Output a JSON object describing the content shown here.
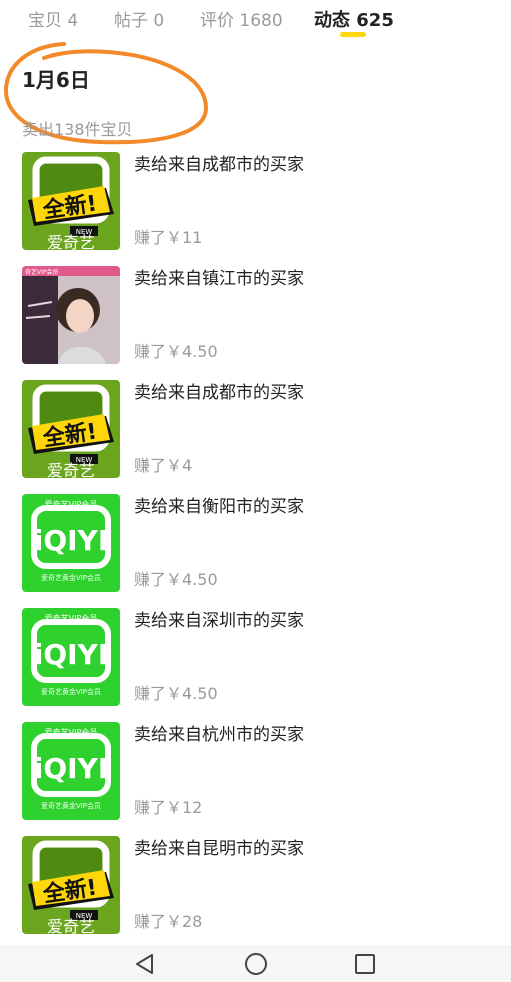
{
  "tabs": [
    {
      "label": "宝贝 4"
    },
    {
      "label": "帖子 0"
    },
    {
      "label": "评价 1680"
    },
    {
      "label": "动态 625"
    }
  ],
  "date_group": {
    "title": "1月6日",
    "summary": "卖出138件宝贝"
  },
  "items": [
    {
      "title": "卖给来自成都市的买家",
      "earned": "赚了￥11",
      "thumb": "aiqiyi-new"
    },
    {
      "title": "卖给来自镇江市的买家",
      "earned": "赚了￥4.50",
      "thumb": "vip-portrait"
    },
    {
      "title": "卖给来自成都市的买家",
      "earned": "赚了￥4",
      "thumb": "aiqiyi-new"
    },
    {
      "title": "卖给来自衡阳市的买家",
      "earned": "赚了￥4.50",
      "thumb": "iqiyi-vip"
    },
    {
      "title": "卖给来自深圳市的买家",
      "earned": "赚了￥4.50",
      "thumb": "iqiyi-vip"
    },
    {
      "title": "卖给来自杭州市的买家",
      "earned": "赚了￥12",
      "thumb": "iqiyi-vip"
    },
    {
      "title": "卖给来自昆明市的买家",
      "earned": "赚了￥28",
      "thumb": "aiqiyi-new"
    }
  ],
  "thumb_text": {
    "new_badge": "全新!",
    "new_small": "NEW",
    "aiqiyi": "爱奇艺",
    "iqiyi_logo": "iQIYI",
    "vip_header": "爱奇艺VIP会员",
    "vip_footer": "爱奇艺黄金VIP会员",
    "portrait_tag": "奇艺VIP会员"
  },
  "colors": {
    "accent_underline": "#ffd60a",
    "annotation_circle": "#f28a2a",
    "green_dark": "#6aa51d",
    "green_bright": "#2fd12e"
  },
  "navbar": {
    "icons": [
      "back-triangle-icon",
      "home-circle-icon",
      "recents-square-icon"
    ]
  }
}
